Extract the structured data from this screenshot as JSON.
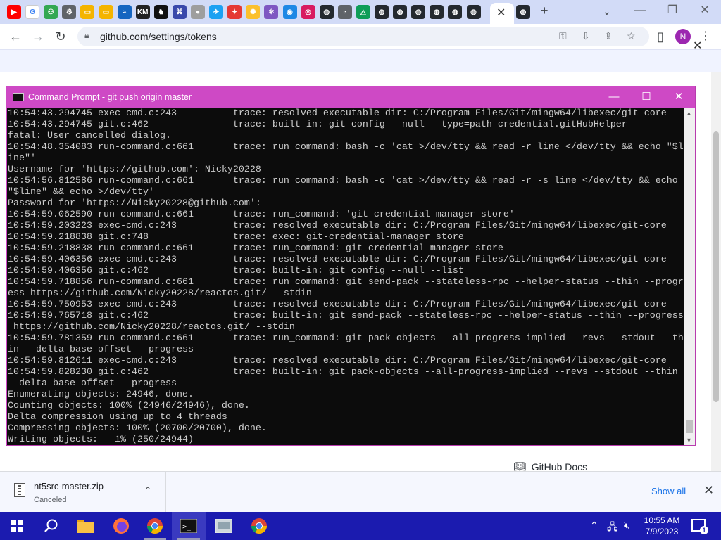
{
  "browser": {
    "tab_favicons": [
      {
        "name": "youtube",
        "color": "#ff0000",
        "glyph": "▶"
      },
      {
        "name": "google",
        "color": "#ffffff",
        "glyph": "G"
      },
      {
        "name": "green-app",
        "color": "#34a853",
        "glyph": "⚇"
      },
      {
        "name": "settings",
        "color": "#5f6368",
        "glyph": "⚙"
      },
      {
        "name": "folder",
        "color": "#f4b400",
        "glyph": "▭"
      },
      {
        "name": "folder-2",
        "color": "#f4b400",
        "glyph": "▭"
      },
      {
        "name": "blue-app",
        "color": "#1565c0",
        "glyph": "≈"
      },
      {
        "name": "km-app",
        "color": "#222222",
        "glyph": "KM"
      },
      {
        "name": "chess-app",
        "color": "#111111",
        "glyph": "♞"
      },
      {
        "name": "diagram-app",
        "color": "#3949ab",
        "glyph": "⌘"
      },
      {
        "name": "circle-app",
        "color": "#9e9e9e",
        "glyph": "●"
      },
      {
        "name": "twitter",
        "color": "#1da1f2",
        "glyph": "✈"
      },
      {
        "name": "mixed-app",
        "color": "#e53935",
        "glyph": "✦"
      },
      {
        "name": "lightbulb",
        "color": "#fbc02d",
        "glyph": "✺"
      },
      {
        "name": "react-app",
        "color": "#7e57c2",
        "glyph": "⚛"
      },
      {
        "name": "sonic-app",
        "color": "#1e88e5",
        "glyph": "◉"
      },
      {
        "name": "instagram",
        "color": "#d81b60",
        "glyph": "◎"
      },
      {
        "name": "github-1",
        "color": "#24292f",
        "glyph": "◍"
      },
      {
        "name": "chromium",
        "color": "#5f6368",
        "glyph": "◔"
      },
      {
        "name": "drive",
        "color": "#0f9d58",
        "glyph": "△"
      },
      {
        "name": "github-2",
        "color": "#24292f",
        "glyph": "◍"
      },
      {
        "name": "github-3",
        "color": "#24292f",
        "glyph": "◍"
      },
      {
        "name": "github-4",
        "color": "#24292f",
        "glyph": "◍"
      },
      {
        "name": "github-5",
        "color": "#24292f",
        "glyph": "◍"
      },
      {
        "name": "github-6",
        "color": "#24292f",
        "glyph": "◍"
      },
      {
        "name": "github-7",
        "color": "#24292f",
        "glyph": "◍"
      },
      {
        "name": "github-8",
        "color": "#24292f",
        "glyph": "◍"
      }
    ],
    "url": "github.com/settings/tokens",
    "profile_initial": "N"
  },
  "page": {
    "docs_link": "GitHub Docs"
  },
  "cmd": {
    "title": "Command Prompt - git  push origin master",
    "lines": [
      "10:54:43.294745 exec-cmd.c:243          trace: resolved executable dir: C:/Program Files/Git/mingw64/libexec/git-core",
      "10:54:43.294745 git.c:462               trace: built-in: git config --null --type=path credential.gitHubHelper",
      "fatal: User cancelled dialog.",
      "10:54:48.354083 run-command.c:661       trace: run_command: bash -c 'cat >/dev/tty && read -r line </dev/tty && echo \"$li",
      "ine\"'",
      "Username for 'https://github.com': Nicky20228",
      "10:54:56.812586 run-command.c:661       trace: run_command: bash -c 'cat >/dev/tty && read -r -s line </dev/tty && echo",
      "\"$line\" && echo >/dev/tty'",
      "Password for 'https://Nicky20228@github.com':",
      "10:54:59.062590 run-command.c:661       trace: run_command: 'git credential-manager store'",
      "10:54:59.203223 exec-cmd.c:243          trace: resolved executable dir: C:/Program Files/Git/mingw64/libexec/git-core",
      "10:54:59.218838 git.c:748               trace: exec: git-credential-manager store",
      "10:54:59.218838 run-command.c:661       trace: run_command: git-credential-manager store",
      "10:54:59.406356 exec-cmd.c:243          trace: resolved executable dir: C:/Program Files/Git/mingw64/libexec/git-core",
      "10:54:59.406356 git.c:462               trace: built-in: git config --null --list",
      "10:54:59.718856 run-command.c:661       trace: run_command: git send-pack --stateless-rpc --helper-status --thin --progr",
      "ess https://github.com/Nicky20228/reactos.git/ --stdin",
      "10:54:59.750953 exec-cmd.c:243          trace: resolved executable dir: C:/Program Files/Git/mingw64/libexec/git-core",
      "10:54:59.765718 git.c:462               trace: built-in: git send-pack --stateless-rpc --helper-status --thin --progress",
      " https://github.com/Nicky20228/reactos.git/ --stdin",
      "10:54:59.781359 run-command.c:661       trace: run_command: git pack-objects --all-progress-implied --revs --stdout --th",
      "in --delta-base-offset --progress",
      "10:54:59.812611 exec-cmd.c:243          trace: resolved executable dir: C:/Program Files/Git/mingw64/libexec/git-core",
      "10:54:59.828230 git.c:462               trace: built-in: git pack-objects --all-progress-implied --revs --stdout --thin",
      "--delta-base-offset --progress",
      "Enumerating objects: 24946, done.",
      "Counting objects: 100% (24946/24946), done.",
      "Delta compression using up to 4 threads",
      "Compressing objects: 100% (20700/20700), done.",
      "Writing objects:   1% (250/24944)"
    ]
  },
  "download": {
    "filename": "nt5src-master.zip",
    "status": "Canceled",
    "show_all": "Show all"
  },
  "taskbar": {
    "time": "10:55 AM",
    "date": "7/9/2023",
    "notification_count": "1"
  }
}
